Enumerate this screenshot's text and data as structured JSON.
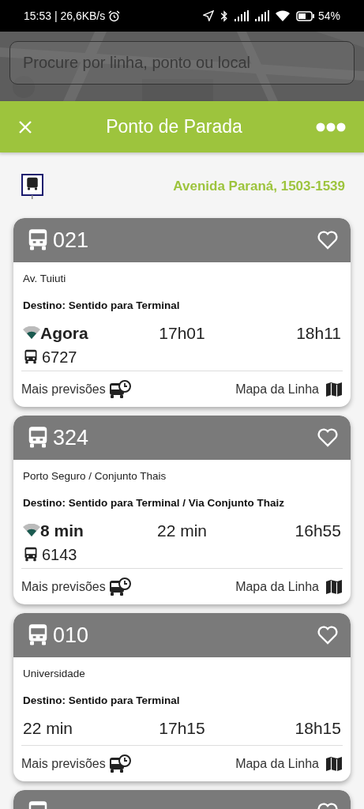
{
  "status_bar": {
    "time": "15:53 | 26,6KB/s",
    "battery": "54%"
  },
  "search": {
    "placeholder": "Procure por linha, ponto ou local"
  },
  "header": {
    "title": "Ponto de Parada"
  },
  "stop": {
    "address": "Avenida Paraná, 1503-1539"
  },
  "lines": [
    {
      "number": "021",
      "favorite": false,
      "name": "Av. Tuiuti",
      "destination": "Destino: Sentido para Terminal",
      "realtime": true,
      "arrivals": [
        "Agora",
        "17h01",
        "18h11"
      ],
      "vehicle": "6727",
      "more_label": "Mais previsões",
      "map_label": "Mapa da Linha"
    },
    {
      "number": "324",
      "favorite": false,
      "name": "Porto Seguro / Conjunto Thais",
      "destination": "Destino: Sentido para Terminal / Via Conjunto Thaiz",
      "realtime": true,
      "arrivals": [
        "8 min",
        "22 min",
        "16h55"
      ],
      "vehicle": "6143",
      "more_label": "Mais previsões",
      "map_label": "Mapa da Linha"
    },
    {
      "number": "010",
      "favorite": false,
      "name": "Universidade",
      "destination": "Destino: Sentido para Terminal",
      "realtime": false,
      "arrivals": [
        "22 min",
        "17h15",
        "18h15"
      ],
      "more_label": "Mais previsões",
      "map_label": "Mapa da Linha"
    },
    {
      "favorite": false
    }
  ]
}
